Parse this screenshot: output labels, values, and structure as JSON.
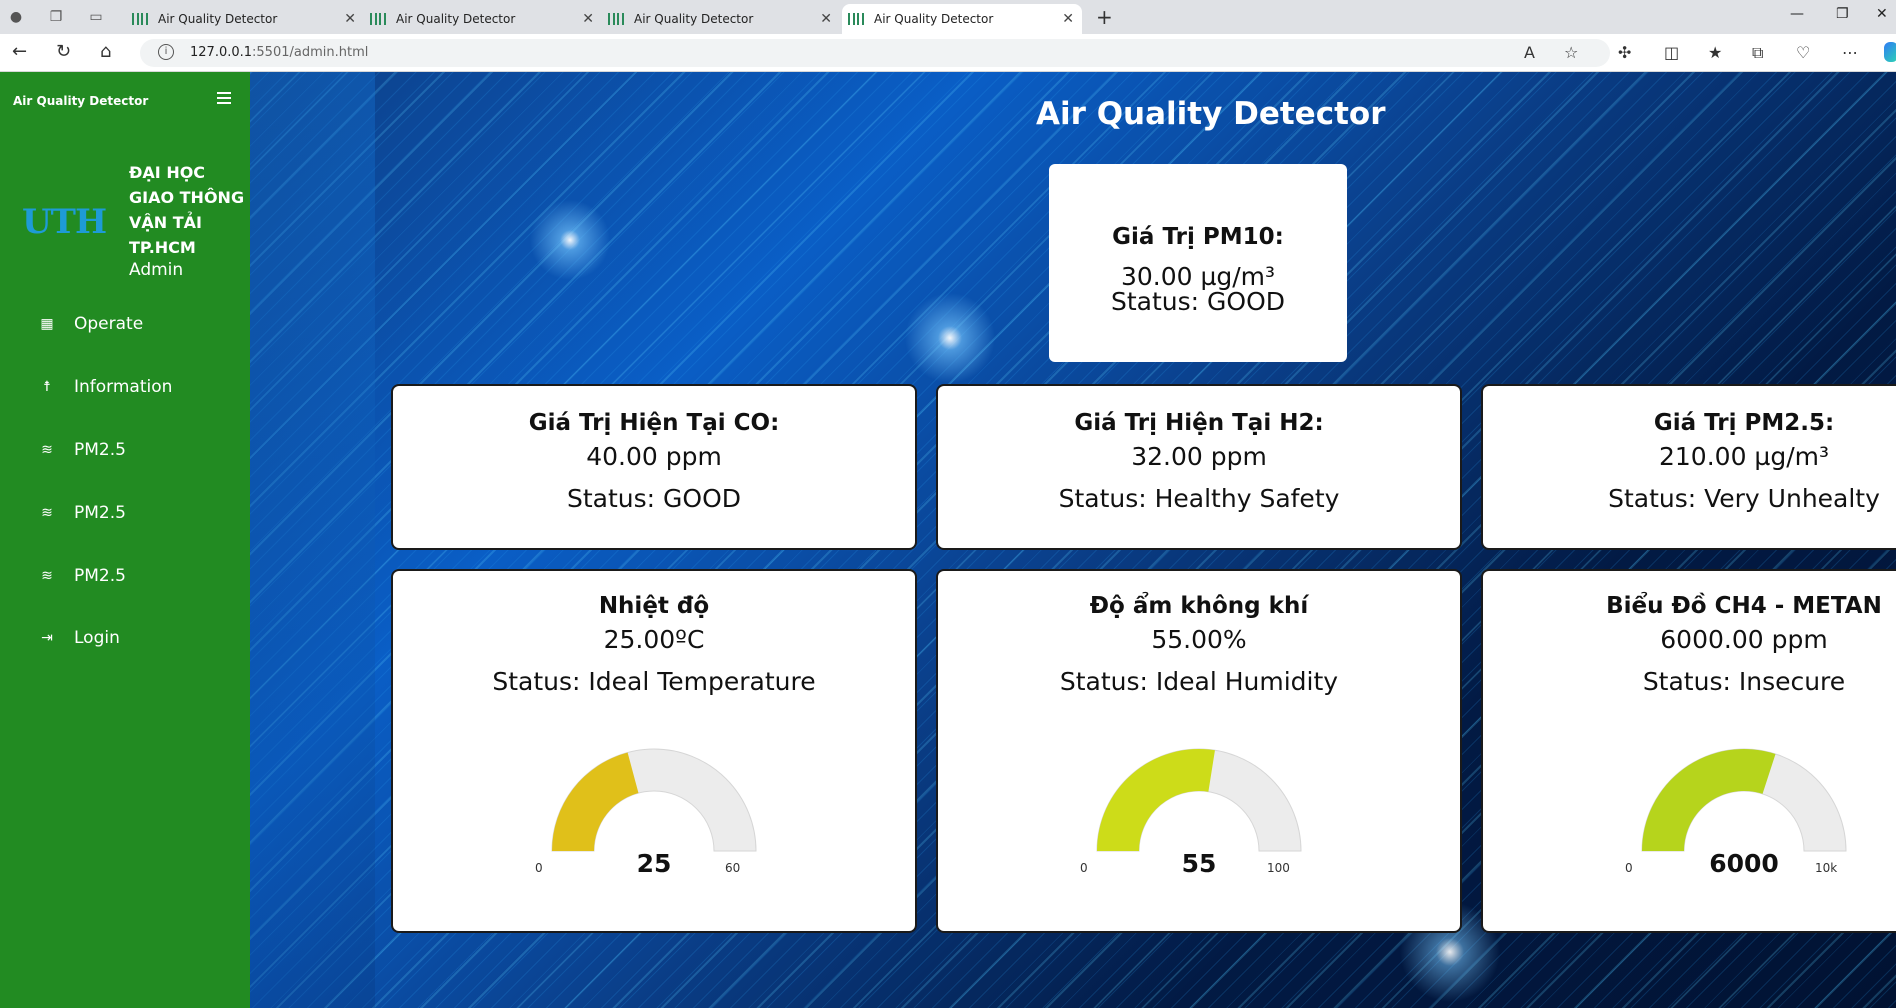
{
  "browser": {
    "tabs": [
      {
        "title": "Air Quality Detector",
        "active": false
      },
      {
        "title": "Air Quality Detector",
        "active": false
      },
      {
        "title": "Air Quality Detector",
        "active": false
      },
      {
        "title": "Air Quality Detector",
        "active": true
      }
    ],
    "url_host": "127.0.0.1",
    "url_rest": ":5501/admin.html"
  },
  "sidebar": {
    "brand": "Air Quality Detector",
    "logo_text": "UTH",
    "university_lines": [
      "ĐẠI HỌC",
      "GIAO THÔNG",
      "VẬN TẢI",
      "TP.HCM"
    ],
    "role": "Admin",
    "items": [
      {
        "label": "Operate",
        "icon": "grid-icon"
      },
      {
        "label": "Information",
        "icon": "person-icon"
      },
      {
        "label": "PM2.5",
        "icon": "wind-icon"
      },
      {
        "label": "PM2.5",
        "icon": "wind-icon"
      },
      {
        "label": "PM2.5",
        "icon": "wind-icon"
      },
      {
        "label": "Login",
        "icon": "login-icon"
      }
    ],
    "color": "#228b22"
  },
  "main": {
    "title": "Air Quality Detector",
    "pm10": {
      "heading": "Giá Trị PM10:",
      "value": "30.00 µg/m³",
      "status": "Status: GOOD"
    },
    "cards": [
      {
        "heading": "Giá Trị Hiện Tại CO:",
        "value": "40.00 ppm",
        "status": "Status: GOOD"
      },
      {
        "heading": "Giá Trị Hiện Tại H2:",
        "value": "32.00 ppm",
        "status": "Status: Healthy Safety"
      },
      {
        "heading": "Giá Trị PM2.5:",
        "value": "210.00 µg/m³",
        "status": "Status: Very Unhealty"
      }
    ],
    "gauge_cards": [
      {
        "heading": "Nhiệt độ",
        "value": "25.00ºC",
        "status": "Status: Ideal Temperature",
        "gauge": {
          "value": 25,
          "min": 0,
          "max": 60,
          "display": "25",
          "min_label": "0",
          "max_label": "60",
          "color": "#e0c01a"
        }
      },
      {
        "heading": "Độ ẩm không khí",
        "value": "55.00%",
        "status": "Status: Ideal Humidity",
        "gauge": {
          "value": 55,
          "min": 0,
          "max": 100,
          "display": "55",
          "min_label": "0",
          "max_label": "100",
          "color": "#cddc19"
        }
      },
      {
        "heading": "Biểu Đồ CH4 - METAN",
        "value": "6000.00 ppm",
        "status": "Status: Insecure",
        "gauge": {
          "value": 6000,
          "min": 0,
          "max": 10000,
          "display": "6000",
          "min_label": "0",
          "max_label": "10k",
          "color": "#b6d41c"
        }
      }
    ]
  }
}
